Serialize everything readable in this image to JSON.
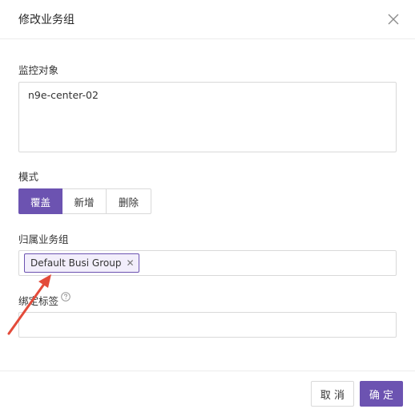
{
  "dialog": {
    "title": "修改业务组",
    "close_icon": "close-icon"
  },
  "form": {
    "target": {
      "label": "监控对象",
      "value": "n9e-center-02"
    },
    "mode": {
      "label": "模式",
      "options": [
        "覆盖",
        "新增",
        "删除"
      ],
      "selected": "覆盖"
    },
    "busi_group": {
      "label": "归属业务组",
      "tags": [
        "Default Busi Group"
      ],
      "tag_close_icon": "close-icon"
    },
    "bind_tags": {
      "label": "绑定标签",
      "help_icon": "question-circle-icon",
      "value": ""
    }
  },
  "footer": {
    "cancel_label": "取 消",
    "ok_label": "确 定"
  },
  "annotation": {
    "arrow_color": "#e34b3a"
  },
  "colors": {
    "primary": "#6c53b1",
    "border": "#d9d9d9",
    "tag_bg": "#f2eefb"
  }
}
